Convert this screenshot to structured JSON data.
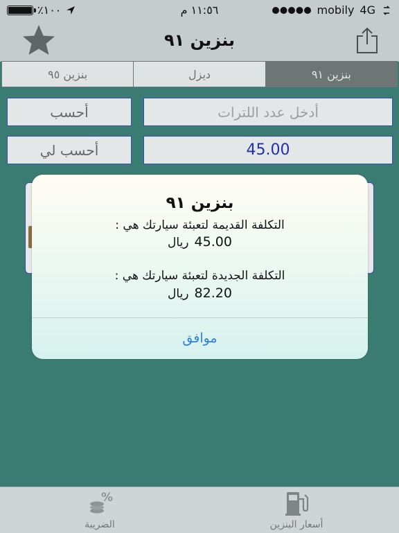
{
  "status_bar": {
    "battery": "٪١٠٠",
    "time": "١١:٥٦ م",
    "network": "4G",
    "carrier": "mobily"
  },
  "nav": {
    "title": "بنزين ٩١",
    "share_icon": "share-icon",
    "favorite_icon": "star-icon"
  },
  "segments": [
    {
      "label": "بنزين ٩٥",
      "active": false
    },
    {
      "label": "ديزل",
      "active": false
    },
    {
      "label": "بنزين ٩١",
      "active": true
    }
  ],
  "form": {
    "calc_button": "أحسب",
    "liters_placeholder": "أدخل عدد اللترات",
    "calc_me_button": "أحسب لي",
    "amount_value": "45.00"
  },
  "alert": {
    "title": "بنزين ٩١",
    "old_cost_label": "التكلفة القديمة لتعبئة سيارتك هي :",
    "old_cost_value": "45.00",
    "currency": "ريال",
    "new_cost_label": "التكلفة الجديدة لتعبئة سيارتك هي :",
    "new_cost_value": "82.20",
    "ok_button": "موافق"
  },
  "tabs": [
    {
      "label": "الضريبة",
      "icon": "percent-coins-icon"
    },
    {
      "label": "أسعار البنزين",
      "icon": "fuel-pump-icon"
    }
  ],
  "colors": {
    "background": "#3b7c72",
    "bar": "#c4cccc",
    "accent": "#2f7fe0",
    "field_border": "#3a4cb0"
  }
}
